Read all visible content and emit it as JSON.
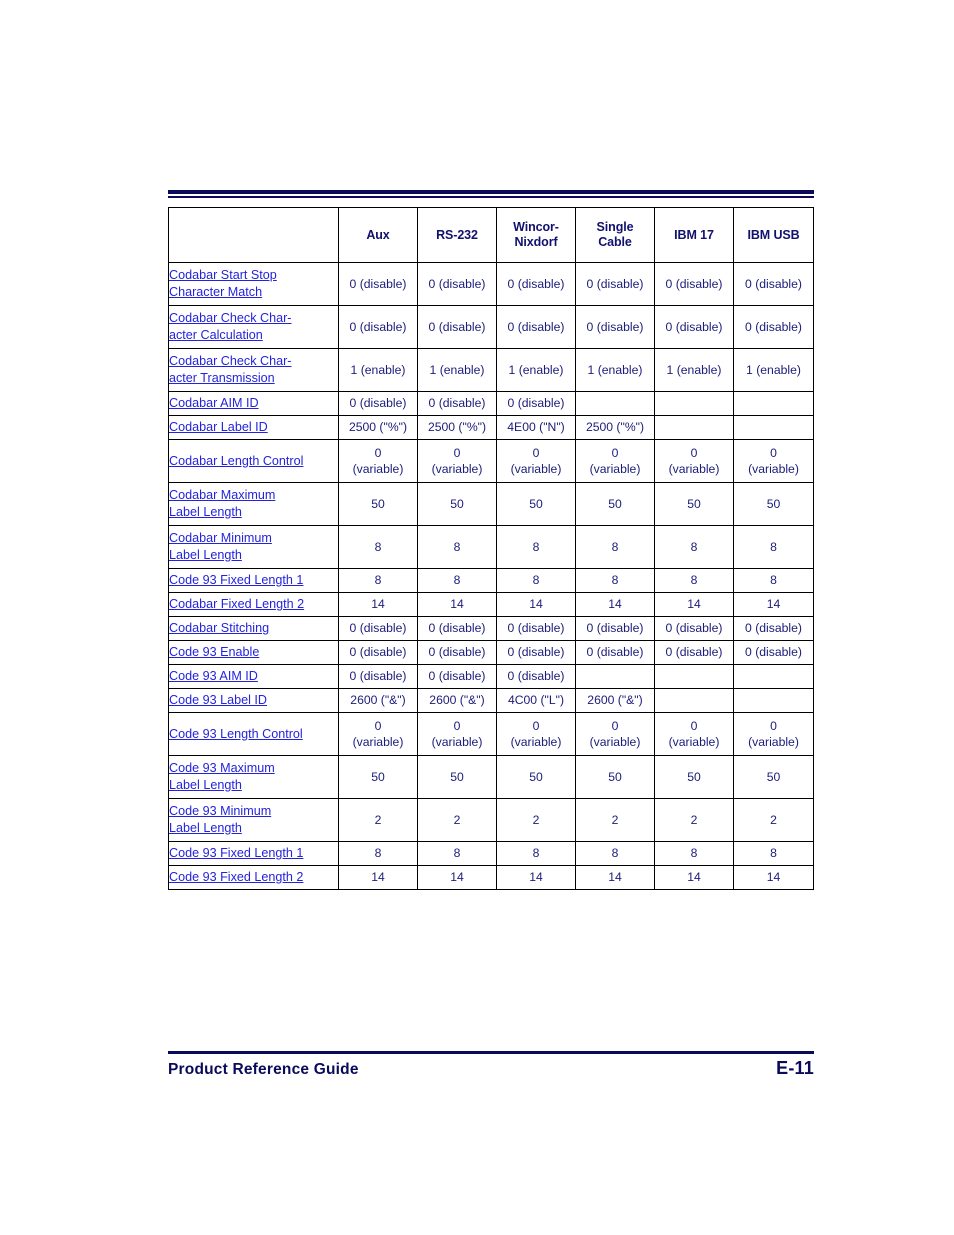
{
  "document": {
    "footer_title": "Product Reference Guide",
    "page_number": "E-11",
    "accent_color": "#0a0a5a",
    "link_color": "#2323dd",
    "value_color": "#1c1c7a"
  },
  "table": {
    "headers": [
      "",
      "Aux",
      "RS-232",
      "Wincor-Nixdorf",
      "Single Cable",
      "IBM 17",
      "IBM USB"
    ],
    "headers_lines": [
      [
        ""
      ],
      [
        "Aux"
      ],
      [
        "RS-232"
      ],
      [
        "Wincor-",
        "Nixdorf"
      ],
      [
        "Single",
        "Cable"
      ],
      [
        "IBM 17"
      ],
      [
        "IBM USB"
      ]
    ],
    "rows": [
      {
        "label_lines": [
          "Codabar Start Stop ",
          "Character Match"
        ],
        "label": "Codabar Start Stop Character Match",
        "cells": [
          [
            "0 (disable)"
          ],
          [
            "0 (disable)"
          ],
          [
            "0 (disable)"
          ],
          [
            "0 (disable)"
          ],
          [
            "0 (disable)"
          ],
          [
            "0 (disable)"
          ]
        ]
      },
      {
        "label_lines": [
          "Codabar Check Char-",
          "acter Calculation"
        ],
        "label": "Codabar Check Character Calculation",
        "cells": [
          [
            "0 (disable)"
          ],
          [
            "0 (disable)"
          ],
          [
            "0 (disable)"
          ],
          [
            "0 (disable)"
          ],
          [
            "0 (disable)"
          ],
          [
            "0 (disable)"
          ]
        ]
      },
      {
        "label_lines": [
          "Codabar Check Char-",
          "acter Transmission"
        ],
        "label": "Codabar Check Character Transmission",
        "cells": [
          [
            "1 (enable)"
          ],
          [
            "1 (enable)"
          ],
          [
            "1 (enable)"
          ],
          [
            "1 (enable)"
          ],
          [
            "1 (enable)"
          ],
          [
            "1 (enable)"
          ]
        ]
      },
      {
        "label_lines": [
          "Codabar AIM ID"
        ],
        "label": "Codabar AIM ID",
        "cells": [
          [
            "0 (disable)"
          ],
          [
            "0 (disable)"
          ],
          [
            "0 (disable)"
          ],
          [
            ""
          ],
          [
            ""
          ],
          [
            ""
          ]
        ]
      },
      {
        "label_lines": [
          "Codabar Label ID"
        ],
        "label": "Codabar Label ID",
        "cells": [
          [
            "2500 (\"%\")"
          ],
          [
            "2500 (\"%\")"
          ],
          [
            "4E00 (\"N\")"
          ],
          [
            "2500 (\"%\")"
          ],
          [
            ""
          ],
          [
            ""
          ]
        ]
      },
      {
        "label_lines": [
          "Codabar Length Control"
        ],
        "label": "Codabar Length Control",
        "cells": [
          [
            "0",
            "(variable)"
          ],
          [
            "0",
            "(variable)"
          ],
          [
            "0",
            "(variable)"
          ],
          [
            "0",
            "(variable)"
          ],
          [
            "0",
            "(variable)"
          ],
          [
            "0",
            "(variable)"
          ]
        ]
      },
      {
        "label_lines": [
          "Codabar Maximum ",
          "Label Length"
        ],
        "label": "Codabar Maximum Label Length",
        "cells": [
          [
            "50"
          ],
          [
            "50"
          ],
          [
            "50"
          ],
          [
            "50"
          ],
          [
            "50"
          ],
          [
            "50"
          ]
        ]
      },
      {
        "label_lines": [
          "Codabar Minimum ",
          "Label Length"
        ],
        "label": "Codabar Minimum Label Length",
        "cells": [
          [
            "8"
          ],
          [
            "8"
          ],
          [
            "8"
          ],
          [
            "8"
          ],
          [
            "8"
          ],
          [
            "8"
          ]
        ]
      },
      {
        "label_lines": [
          "Code 93 Fixed Length 1"
        ],
        "label": "Code 93 Fixed Length 1",
        "cells": [
          [
            "8"
          ],
          [
            "8"
          ],
          [
            "8"
          ],
          [
            "8"
          ],
          [
            "8"
          ],
          [
            "8"
          ]
        ]
      },
      {
        "label_lines": [
          "Codabar Fixed Length 2"
        ],
        "label": "Codabar Fixed Length 2",
        "cells": [
          [
            "14"
          ],
          [
            "14"
          ],
          [
            "14"
          ],
          [
            "14"
          ],
          [
            "14"
          ],
          [
            "14"
          ]
        ]
      },
      {
        "label_lines": [
          "Codabar Stitching"
        ],
        "label": "Codabar Stitching",
        "cells": [
          [
            "0 (disable)"
          ],
          [
            "0 (disable)"
          ],
          [
            "0 (disable)"
          ],
          [
            "0 (disable)"
          ],
          [
            "0 (disable)"
          ],
          [
            "0 (disable)"
          ]
        ]
      },
      {
        "label_lines": [
          "Code 93 Enable"
        ],
        "label": "Code 93 Enable",
        "cells": [
          [
            "0 (disable)"
          ],
          [
            "0 (disable)"
          ],
          [
            "0 (disable)"
          ],
          [
            "0 (disable)"
          ],
          [
            "0 (disable)"
          ],
          [
            "0 (disable)"
          ]
        ]
      },
      {
        "label_lines": [
          "Code 93 AIM ID"
        ],
        "label": "Code 93 AIM ID",
        "cells": [
          [
            "0 (disable)"
          ],
          [
            "0 (disable)"
          ],
          [
            "0 (disable)"
          ],
          [
            ""
          ],
          [
            ""
          ],
          [
            ""
          ]
        ]
      },
      {
        "label_lines": [
          "Code 93 Label ID"
        ],
        "label": "Code 93 Label ID",
        "cells": [
          [
            "2600 (\"&\")"
          ],
          [
            "2600 (\"&\")"
          ],
          [
            "4C00 (\"L\")"
          ],
          [
            "2600 (\"&\")"
          ],
          [
            ""
          ],
          [
            ""
          ]
        ]
      },
      {
        "label_lines": [
          "Code 93 Length Control"
        ],
        "label": "Code 93 Length Control",
        "cells": [
          [
            "0",
            "(variable)"
          ],
          [
            "0",
            "(variable)"
          ],
          [
            "0",
            "(variable)"
          ],
          [
            "0",
            "(variable)"
          ],
          [
            "0",
            "(variable)"
          ],
          [
            "0",
            "(variable)"
          ]
        ]
      },
      {
        "label_lines": [
          "Code 93 Maximum ",
          "Label Length"
        ],
        "label": "Code 93 Maximum Label Length",
        "cells": [
          [
            "50"
          ],
          [
            "50"
          ],
          [
            "50"
          ],
          [
            "50"
          ],
          [
            "50"
          ],
          [
            "50"
          ]
        ]
      },
      {
        "label_lines": [
          "Code 93 Minimum ",
          "Label Length"
        ],
        "label": "Code 93 Minimum Label Length",
        "cells": [
          [
            "2"
          ],
          [
            "2"
          ],
          [
            "2"
          ],
          [
            "2"
          ],
          [
            "2"
          ],
          [
            "2"
          ]
        ]
      },
      {
        "label_lines": [
          "Code 93 Fixed Length 1"
        ],
        "label": "Code 93 Fixed Length 1",
        "cells": [
          [
            "8"
          ],
          [
            "8"
          ],
          [
            "8"
          ],
          [
            "8"
          ],
          [
            "8"
          ],
          [
            "8"
          ]
        ]
      },
      {
        "label_lines": [
          "Code 93 Fixed Length 2"
        ],
        "label": "Code 93 Fixed Length 2",
        "cells": [
          [
            "14"
          ],
          [
            "14"
          ],
          [
            "14"
          ],
          [
            "14"
          ],
          [
            "14"
          ],
          [
            "14"
          ]
        ]
      }
    ]
  }
}
